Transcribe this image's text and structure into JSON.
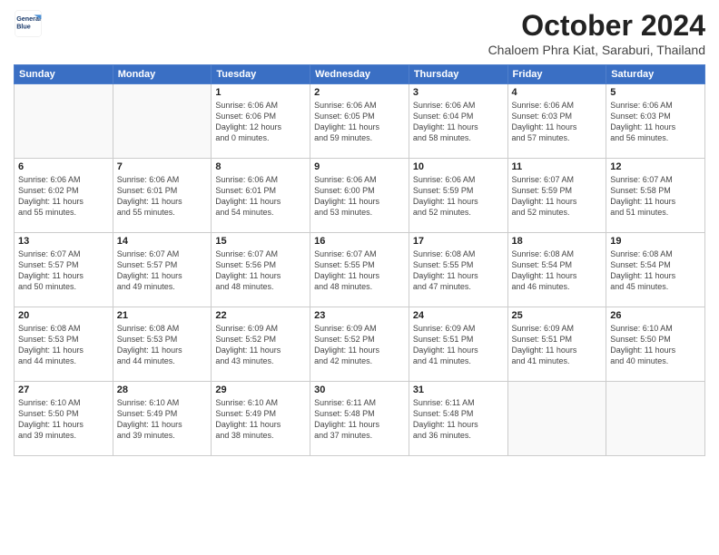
{
  "logo": {
    "line1": "General",
    "line2": "Blue"
  },
  "header": {
    "month": "October 2024",
    "location": "Chaloem Phra Kiat, Saraburi, Thailand"
  },
  "weekdays": [
    "Sunday",
    "Monday",
    "Tuesday",
    "Wednesday",
    "Thursday",
    "Friday",
    "Saturday"
  ],
  "weeks": [
    [
      {
        "day": "",
        "info": ""
      },
      {
        "day": "",
        "info": ""
      },
      {
        "day": "1",
        "info": "Sunrise: 6:06 AM\nSunset: 6:06 PM\nDaylight: 12 hours\nand 0 minutes."
      },
      {
        "day": "2",
        "info": "Sunrise: 6:06 AM\nSunset: 6:05 PM\nDaylight: 11 hours\nand 59 minutes."
      },
      {
        "day": "3",
        "info": "Sunrise: 6:06 AM\nSunset: 6:04 PM\nDaylight: 11 hours\nand 58 minutes."
      },
      {
        "day": "4",
        "info": "Sunrise: 6:06 AM\nSunset: 6:03 PM\nDaylight: 11 hours\nand 57 minutes."
      },
      {
        "day": "5",
        "info": "Sunrise: 6:06 AM\nSunset: 6:03 PM\nDaylight: 11 hours\nand 56 minutes."
      }
    ],
    [
      {
        "day": "6",
        "info": "Sunrise: 6:06 AM\nSunset: 6:02 PM\nDaylight: 11 hours\nand 55 minutes."
      },
      {
        "day": "7",
        "info": "Sunrise: 6:06 AM\nSunset: 6:01 PM\nDaylight: 11 hours\nand 55 minutes."
      },
      {
        "day": "8",
        "info": "Sunrise: 6:06 AM\nSunset: 6:01 PM\nDaylight: 11 hours\nand 54 minutes."
      },
      {
        "day": "9",
        "info": "Sunrise: 6:06 AM\nSunset: 6:00 PM\nDaylight: 11 hours\nand 53 minutes."
      },
      {
        "day": "10",
        "info": "Sunrise: 6:06 AM\nSunset: 5:59 PM\nDaylight: 11 hours\nand 52 minutes."
      },
      {
        "day": "11",
        "info": "Sunrise: 6:07 AM\nSunset: 5:59 PM\nDaylight: 11 hours\nand 52 minutes."
      },
      {
        "day": "12",
        "info": "Sunrise: 6:07 AM\nSunset: 5:58 PM\nDaylight: 11 hours\nand 51 minutes."
      }
    ],
    [
      {
        "day": "13",
        "info": "Sunrise: 6:07 AM\nSunset: 5:57 PM\nDaylight: 11 hours\nand 50 minutes."
      },
      {
        "day": "14",
        "info": "Sunrise: 6:07 AM\nSunset: 5:57 PM\nDaylight: 11 hours\nand 49 minutes."
      },
      {
        "day": "15",
        "info": "Sunrise: 6:07 AM\nSunset: 5:56 PM\nDaylight: 11 hours\nand 48 minutes."
      },
      {
        "day": "16",
        "info": "Sunrise: 6:07 AM\nSunset: 5:55 PM\nDaylight: 11 hours\nand 48 minutes."
      },
      {
        "day": "17",
        "info": "Sunrise: 6:08 AM\nSunset: 5:55 PM\nDaylight: 11 hours\nand 47 minutes."
      },
      {
        "day": "18",
        "info": "Sunrise: 6:08 AM\nSunset: 5:54 PM\nDaylight: 11 hours\nand 46 minutes."
      },
      {
        "day": "19",
        "info": "Sunrise: 6:08 AM\nSunset: 5:54 PM\nDaylight: 11 hours\nand 45 minutes."
      }
    ],
    [
      {
        "day": "20",
        "info": "Sunrise: 6:08 AM\nSunset: 5:53 PM\nDaylight: 11 hours\nand 44 minutes."
      },
      {
        "day": "21",
        "info": "Sunrise: 6:08 AM\nSunset: 5:53 PM\nDaylight: 11 hours\nand 44 minutes."
      },
      {
        "day": "22",
        "info": "Sunrise: 6:09 AM\nSunset: 5:52 PM\nDaylight: 11 hours\nand 43 minutes."
      },
      {
        "day": "23",
        "info": "Sunrise: 6:09 AM\nSunset: 5:52 PM\nDaylight: 11 hours\nand 42 minutes."
      },
      {
        "day": "24",
        "info": "Sunrise: 6:09 AM\nSunset: 5:51 PM\nDaylight: 11 hours\nand 41 minutes."
      },
      {
        "day": "25",
        "info": "Sunrise: 6:09 AM\nSunset: 5:51 PM\nDaylight: 11 hours\nand 41 minutes."
      },
      {
        "day": "26",
        "info": "Sunrise: 6:10 AM\nSunset: 5:50 PM\nDaylight: 11 hours\nand 40 minutes."
      }
    ],
    [
      {
        "day": "27",
        "info": "Sunrise: 6:10 AM\nSunset: 5:50 PM\nDaylight: 11 hours\nand 39 minutes."
      },
      {
        "day": "28",
        "info": "Sunrise: 6:10 AM\nSunset: 5:49 PM\nDaylight: 11 hours\nand 39 minutes."
      },
      {
        "day": "29",
        "info": "Sunrise: 6:10 AM\nSunset: 5:49 PM\nDaylight: 11 hours\nand 38 minutes."
      },
      {
        "day": "30",
        "info": "Sunrise: 6:11 AM\nSunset: 5:48 PM\nDaylight: 11 hours\nand 37 minutes."
      },
      {
        "day": "31",
        "info": "Sunrise: 6:11 AM\nSunset: 5:48 PM\nDaylight: 11 hours\nand 36 minutes."
      },
      {
        "day": "",
        "info": ""
      },
      {
        "day": "",
        "info": ""
      }
    ]
  ]
}
